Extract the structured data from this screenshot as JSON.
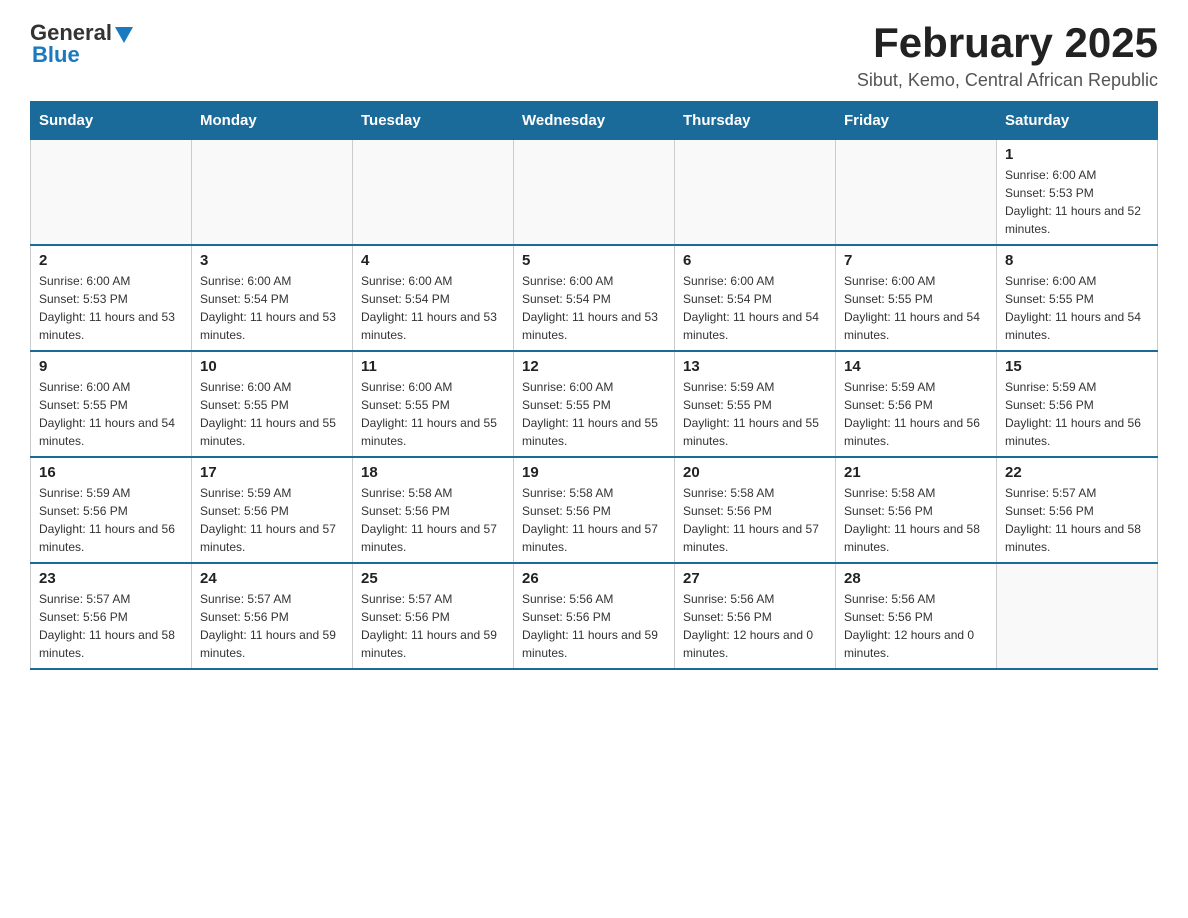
{
  "header": {
    "logo": {
      "general": "General",
      "blue": "Blue"
    },
    "title": "February 2025",
    "subtitle": "Sibut, Kemo, Central African Republic"
  },
  "days_of_week": [
    "Sunday",
    "Monday",
    "Tuesday",
    "Wednesday",
    "Thursday",
    "Friday",
    "Saturday"
  ],
  "weeks": [
    [
      {
        "day": "",
        "sunrise": "",
        "sunset": "",
        "daylight": ""
      },
      {
        "day": "",
        "sunrise": "",
        "sunset": "",
        "daylight": ""
      },
      {
        "day": "",
        "sunrise": "",
        "sunset": "",
        "daylight": ""
      },
      {
        "day": "",
        "sunrise": "",
        "sunset": "",
        "daylight": ""
      },
      {
        "day": "",
        "sunrise": "",
        "sunset": "",
        "daylight": ""
      },
      {
        "day": "",
        "sunrise": "",
        "sunset": "",
        "daylight": ""
      },
      {
        "day": "1",
        "sunrise": "Sunrise: 6:00 AM",
        "sunset": "Sunset: 5:53 PM",
        "daylight": "Daylight: 11 hours and 52 minutes."
      }
    ],
    [
      {
        "day": "2",
        "sunrise": "Sunrise: 6:00 AM",
        "sunset": "Sunset: 5:53 PM",
        "daylight": "Daylight: 11 hours and 53 minutes."
      },
      {
        "day": "3",
        "sunrise": "Sunrise: 6:00 AM",
        "sunset": "Sunset: 5:54 PM",
        "daylight": "Daylight: 11 hours and 53 minutes."
      },
      {
        "day": "4",
        "sunrise": "Sunrise: 6:00 AM",
        "sunset": "Sunset: 5:54 PM",
        "daylight": "Daylight: 11 hours and 53 minutes."
      },
      {
        "day": "5",
        "sunrise": "Sunrise: 6:00 AM",
        "sunset": "Sunset: 5:54 PM",
        "daylight": "Daylight: 11 hours and 53 minutes."
      },
      {
        "day": "6",
        "sunrise": "Sunrise: 6:00 AM",
        "sunset": "Sunset: 5:54 PM",
        "daylight": "Daylight: 11 hours and 54 minutes."
      },
      {
        "day": "7",
        "sunrise": "Sunrise: 6:00 AM",
        "sunset": "Sunset: 5:55 PM",
        "daylight": "Daylight: 11 hours and 54 minutes."
      },
      {
        "day": "8",
        "sunrise": "Sunrise: 6:00 AM",
        "sunset": "Sunset: 5:55 PM",
        "daylight": "Daylight: 11 hours and 54 minutes."
      }
    ],
    [
      {
        "day": "9",
        "sunrise": "Sunrise: 6:00 AM",
        "sunset": "Sunset: 5:55 PM",
        "daylight": "Daylight: 11 hours and 54 minutes."
      },
      {
        "day": "10",
        "sunrise": "Sunrise: 6:00 AM",
        "sunset": "Sunset: 5:55 PM",
        "daylight": "Daylight: 11 hours and 55 minutes."
      },
      {
        "day": "11",
        "sunrise": "Sunrise: 6:00 AM",
        "sunset": "Sunset: 5:55 PM",
        "daylight": "Daylight: 11 hours and 55 minutes."
      },
      {
        "day": "12",
        "sunrise": "Sunrise: 6:00 AM",
        "sunset": "Sunset: 5:55 PM",
        "daylight": "Daylight: 11 hours and 55 minutes."
      },
      {
        "day": "13",
        "sunrise": "Sunrise: 5:59 AM",
        "sunset": "Sunset: 5:55 PM",
        "daylight": "Daylight: 11 hours and 55 minutes."
      },
      {
        "day": "14",
        "sunrise": "Sunrise: 5:59 AM",
        "sunset": "Sunset: 5:56 PM",
        "daylight": "Daylight: 11 hours and 56 minutes."
      },
      {
        "day": "15",
        "sunrise": "Sunrise: 5:59 AM",
        "sunset": "Sunset: 5:56 PM",
        "daylight": "Daylight: 11 hours and 56 minutes."
      }
    ],
    [
      {
        "day": "16",
        "sunrise": "Sunrise: 5:59 AM",
        "sunset": "Sunset: 5:56 PM",
        "daylight": "Daylight: 11 hours and 56 minutes."
      },
      {
        "day": "17",
        "sunrise": "Sunrise: 5:59 AM",
        "sunset": "Sunset: 5:56 PM",
        "daylight": "Daylight: 11 hours and 57 minutes."
      },
      {
        "day": "18",
        "sunrise": "Sunrise: 5:58 AM",
        "sunset": "Sunset: 5:56 PM",
        "daylight": "Daylight: 11 hours and 57 minutes."
      },
      {
        "day": "19",
        "sunrise": "Sunrise: 5:58 AM",
        "sunset": "Sunset: 5:56 PM",
        "daylight": "Daylight: 11 hours and 57 minutes."
      },
      {
        "day": "20",
        "sunrise": "Sunrise: 5:58 AM",
        "sunset": "Sunset: 5:56 PM",
        "daylight": "Daylight: 11 hours and 57 minutes."
      },
      {
        "day": "21",
        "sunrise": "Sunrise: 5:58 AM",
        "sunset": "Sunset: 5:56 PM",
        "daylight": "Daylight: 11 hours and 58 minutes."
      },
      {
        "day": "22",
        "sunrise": "Sunrise: 5:57 AM",
        "sunset": "Sunset: 5:56 PM",
        "daylight": "Daylight: 11 hours and 58 minutes."
      }
    ],
    [
      {
        "day": "23",
        "sunrise": "Sunrise: 5:57 AM",
        "sunset": "Sunset: 5:56 PM",
        "daylight": "Daylight: 11 hours and 58 minutes."
      },
      {
        "day": "24",
        "sunrise": "Sunrise: 5:57 AM",
        "sunset": "Sunset: 5:56 PM",
        "daylight": "Daylight: 11 hours and 59 minutes."
      },
      {
        "day": "25",
        "sunrise": "Sunrise: 5:57 AM",
        "sunset": "Sunset: 5:56 PM",
        "daylight": "Daylight: 11 hours and 59 minutes."
      },
      {
        "day": "26",
        "sunrise": "Sunrise: 5:56 AM",
        "sunset": "Sunset: 5:56 PM",
        "daylight": "Daylight: 11 hours and 59 minutes."
      },
      {
        "day": "27",
        "sunrise": "Sunrise: 5:56 AM",
        "sunset": "Sunset: 5:56 PM",
        "daylight": "Daylight: 12 hours and 0 minutes."
      },
      {
        "day": "28",
        "sunrise": "Sunrise: 5:56 AM",
        "sunset": "Sunset: 5:56 PM",
        "daylight": "Daylight: 12 hours and 0 minutes."
      },
      {
        "day": "",
        "sunrise": "",
        "sunset": "",
        "daylight": ""
      }
    ]
  ]
}
